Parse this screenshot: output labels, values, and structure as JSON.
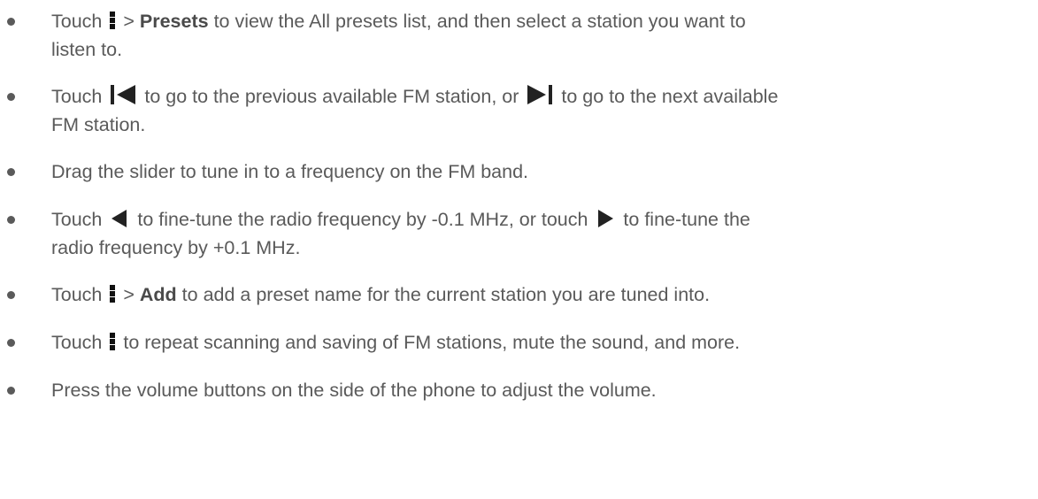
{
  "items": [
    {
      "l1a": "Touch",
      "icon1": "menu-icon",
      "l1b": ">",
      "bold": "Presets",
      "l1c": "to view the All presets list, and then select a station you want to",
      "l2": "listen to."
    },
    {
      "l1a": "Touch",
      "icon1": "previous-station-icon",
      "l1b": "to go to the previous available FM station, or",
      "icon2": "next-station-icon",
      "l1c": "to go to the next available",
      "l2": "FM station."
    },
    {
      "l1": "Drag the slider to tune in to a frequency on the FM band."
    },
    {
      "l1a": "Touch",
      "icon1": "fine-tune-down-icon",
      "l1b": "to fine-tune the radio frequency by -0.1 MHz, or touch",
      "icon2": "fine-tune-up-icon",
      "l1c": "to fine-tune the",
      "l2": "radio frequency by +0.1 MHz."
    },
    {
      "l1a": "Touch",
      "icon1": "menu-icon",
      "l1b": ">",
      "bold": "Add",
      "l1c": "to add a preset name for the current station you are tuned into."
    },
    {
      "l1a": "Touch",
      "icon1": "menu-icon",
      "l1c": "to repeat scanning and saving of FM stations, mute the sound, and more."
    },
    {
      "l1": "Press the volume buttons on the side of the phone to adjust the volume."
    }
  ]
}
